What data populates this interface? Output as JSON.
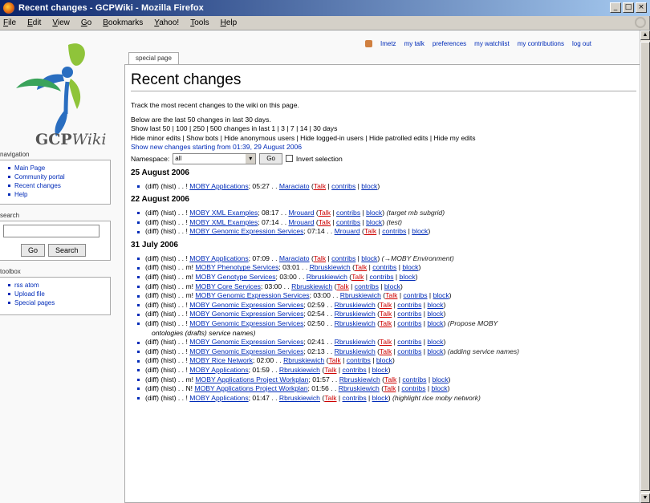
{
  "window": {
    "title": "Recent changes - GCPWiki - Mozilla Firefox",
    "controls": [
      "_",
      "□",
      "×"
    ]
  },
  "menubar": [
    "File",
    "Edit",
    "View",
    "Go",
    "Bookmarks",
    "Yahoo!",
    "Tools",
    "Help"
  ],
  "personal": {
    "items": [
      "Imetz",
      "my talk",
      "preferences",
      "my watchlist",
      "my contributions",
      "log out"
    ]
  },
  "sidebar": {
    "logo_text": "GCP",
    "logo_text_italic": "Wiki",
    "navigation_heading": "navigation",
    "navigation": [
      "Main Page",
      "Community portal",
      "Recent changes",
      "Help"
    ],
    "search_heading": "search",
    "search_go": "Go",
    "search_search": "Search",
    "toolbox_heading": "toolbox",
    "toolbox": [
      "rss  atom",
      "Upload file",
      "Special pages"
    ]
  },
  "tab": "special page",
  "page": {
    "title": "Recent changes",
    "intro": "Track the most recent changes to the wiki on this page.",
    "below": "Below are the last 50 changes in last 30 days.",
    "show_last": "Show last 50 | 100 | 250 | 500 changes in last 1 | 3 | 7 | 14 | 30 days",
    "hide_line": "Hide minor edits | Show bots | Hide anonymous users | Hide logged-in users | Hide patrolled edits | Hide my edits",
    "show_new": "Show new changes starting from 01:39, 29 August 2006",
    "namespace_label": "Namespace:",
    "namespace_value": "all",
    "go_button": "Go",
    "invert_label": "Invert selection"
  },
  "days": [
    {
      "date": "25 August 2006",
      "entries": [
        {
          "prefix": "(diff) (hist) . . ! ",
          "page": "MOBY Applications",
          "time": "; 05:27 . . ",
          "user": "Maraciato",
          "comment": ""
        }
      ]
    },
    {
      "date": "22 August 2006",
      "entries": [
        {
          "prefix": "(diff) (hist) . . ! ",
          "page": "MOBY XML Examples",
          "time": "; 08:17 . . ",
          "user": "Mrouard",
          "comment": "(target mb subgrid)"
        },
        {
          "prefix": "(diff) (hist) . . ! ",
          "page": "MOBY XML Examples",
          "time": "; 07:14 . . ",
          "user": "Mrouard",
          "comment": "(test)"
        },
        {
          "prefix": "(diff) (hist) . . ! ",
          "page": "MOBY Genomic Expression Services",
          "time": "; 07:14 . . ",
          "user": "Mrouard",
          "comment": ""
        }
      ]
    },
    {
      "date": "31 July 2006",
      "entries": [
        {
          "prefix": "(diff) (hist) . . ! ",
          "page": "MOBY Applications",
          "time": "; 07:09 . . ",
          "user": "Maraciato",
          "comment": "(→MOBY Environment)"
        },
        {
          "prefix": "(diff) (hist) . . m! ",
          "page": "MOBY Phenotype Services",
          "time": "; 03:01 . . ",
          "user": "Rbruskiewich",
          "comment": ""
        },
        {
          "prefix": "(diff) (hist) . . m! ",
          "page": "MOBY Genotype Services",
          "time": "; 03:00 . . ",
          "user": "Rbruskiewich",
          "comment": ""
        },
        {
          "prefix": "(diff) (hist) . . m! ",
          "page": "MOBY Core Services",
          "time": "; 03:00 . . ",
          "user": "Rbruskiewich",
          "comment": ""
        },
        {
          "prefix": "(diff) (hist) . . m! ",
          "page": "MOBY Genomic Expression Services",
          "time": "; 03:00 . . ",
          "user": "Rbruskiewich",
          "comment": ""
        },
        {
          "prefix": "(diff) (hist) . . ! ",
          "page": "MOBY Genomic Expression Services",
          "time": "; 02:59 . . ",
          "user": "Rbruskiewich",
          "comment": ""
        },
        {
          "prefix": "(diff) (hist) . . ! ",
          "page": "MOBY Genomic Expression Services",
          "time": "; 02:54 . . ",
          "user": "Rbruskiewich",
          "comment": ""
        },
        {
          "prefix": "(diff) (hist) . . ! ",
          "page": "MOBY Genomic Expression Services",
          "time": "; 02:50 . . ",
          "user": "Rbruskiewich",
          "comment": "(Propose MOBY",
          "wrap": "ontologies (drafts) service names)"
        },
        {
          "prefix": "(diff) (hist) . . ! ",
          "page": "MOBY Genomic Expression Services",
          "time": "; 02:41 . . ",
          "user": "Rbruskiewich",
          "comment": ""
        },
        {
          "prefix": "(diff) (hist) . . ! ",
          "page": "MOBY Genomic Expression Services",
          "time": "; 02:13 . . ",
          "user": "Rbruskiewich",
          "comment": "(adding service names)"
        },
        {
          "prefix": "(diff) (hist) . . ! ",
          "page": "MOBY Rice Network",
          "time": "; 02:00 . . ",
          "user": "Rbruskiewich",
          "comment": ""
        },
        {
          "prefix": "(diff) (hist) . . ! ",
          "page": "MOBY Applications",
          "time": "; 01:59 . . ",
          "user": "Rbruskiewich",
          "comment": ""
        },
        {
          "prefix": "(diff) (hist) . . m! ",
          "page": "MOBY Applications Project Workplan",
          "time": "; 01:57 . . ",
          "user": "Rbruskiewich",
          "comment": ""
        },
        {
          "prefix": "(diff) (hist) . . N! ",
          "page": "MOBY Applications Project Workplan",
          "time": "; 01:56 . . ",
          "user": "Rbruskiewich",
          "comment": ""
        },
        {
          "prefix": "(diff) (hist) . . ! ",
          "page": "MOBY Applications",
          "time": "; 01:47 . . ",
          "user": "Rbruskiewich",
          "comment": "(highlight rice moby network)"
        }
      ]
    }
  ],
  "entry_labels": {
    "talk": "Talk",
    "contribs": "contribs",
    "block": "block"
  }
}
